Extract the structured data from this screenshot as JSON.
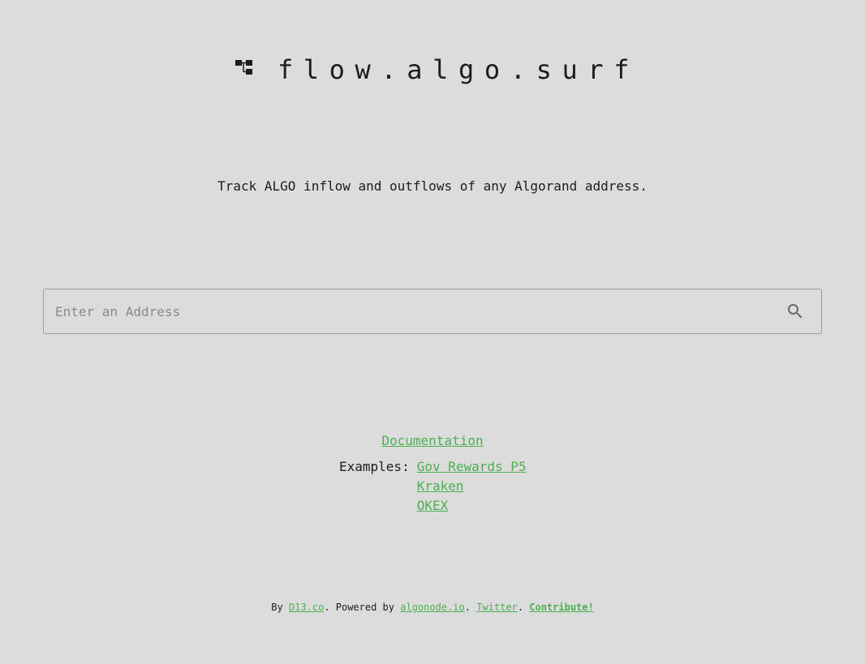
{
  "header": {
    "logo_icon": "flow-tree-icon",
    "title": "flow.algo.surf"
  },
  "tagline": "Track ALGO inflow and outflows of any Algorand address.",
  "search": {
    "placeholder": "Enter an Address",
    "value": "",
    "icon": "search-icon"
  },
  "links": {
    "documentation": "Documentation",
    "examples_label": "Examples:",
    "examples": [
      "Gov Rewards P5",
      "Kraken",
      "OKEX"
    ]
  },
  "footer": {
    "by_text": "By",
    "d13": "D13.co",
    "powered_text": ". Powered by",
    "algonode": "algonode.io",
    "sep1": ".",
    "twitter": "Twitter",
    "sep2": ".",
    "contribute": "Contribute!"
  },
  "colors": {
    "background": "#dcdcdc",
    "link": "#4caf50",
    "text": "#1c1c1c",
    "border": "#9b9b9b"
  }
}
